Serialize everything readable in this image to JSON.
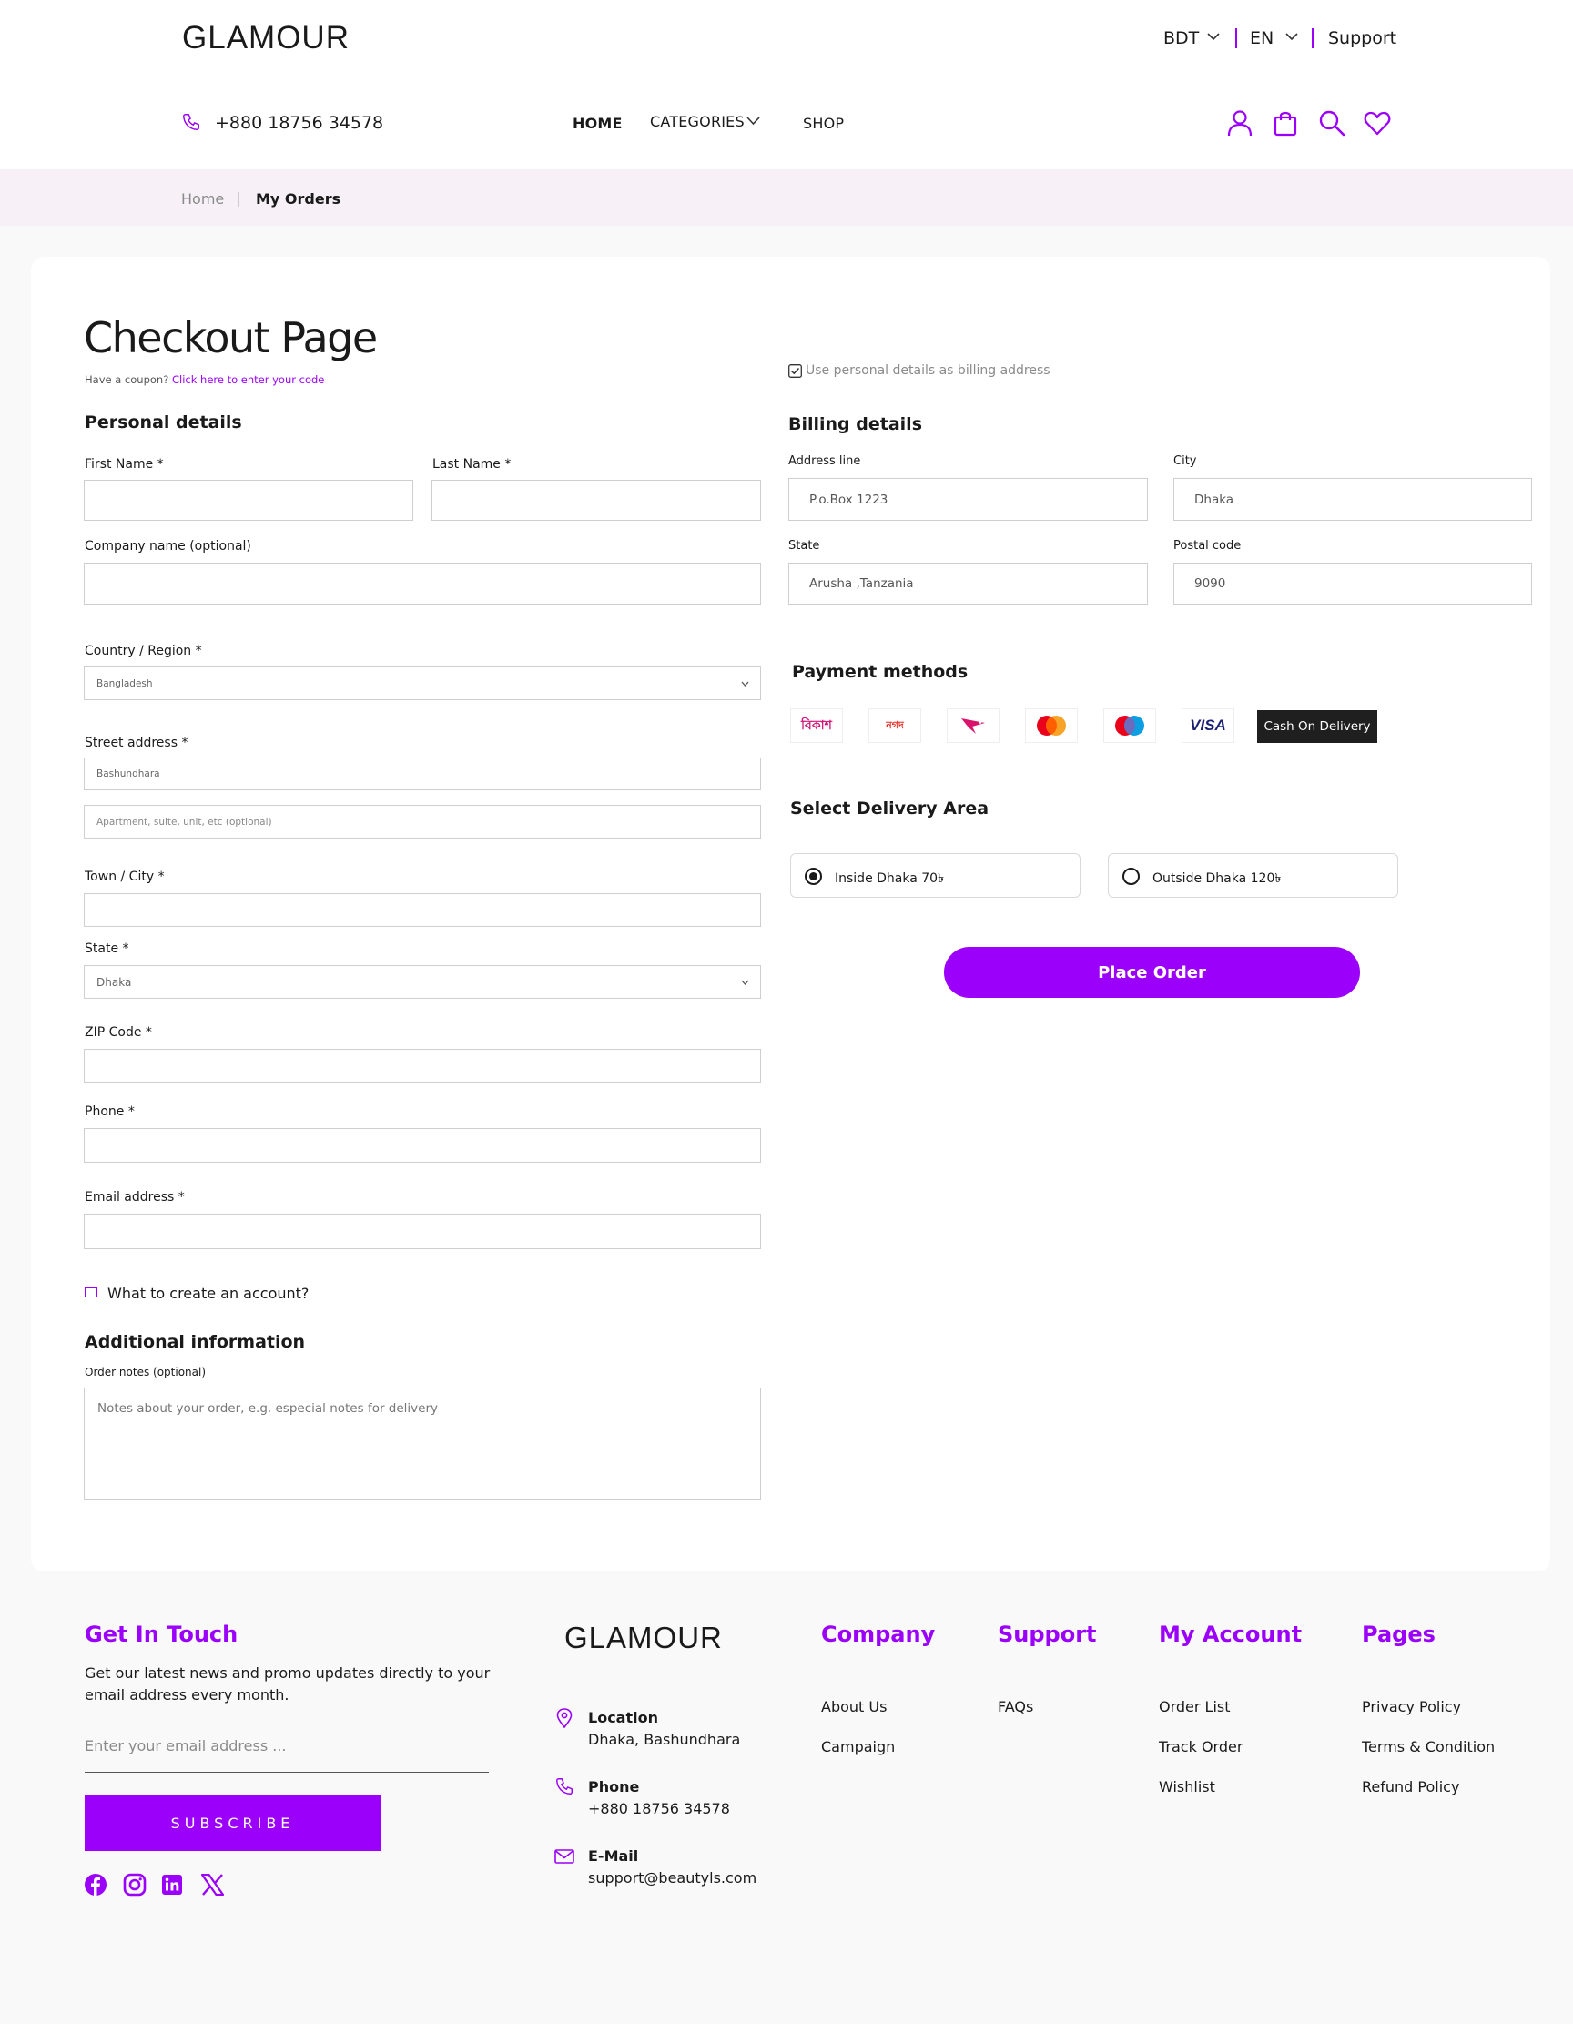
{
  "header": {
    "logo": "GLAMOUR",
    "currency": "BDT",
    "language": "EN",
    "support": "Support",
    "phone": "+880 18756 34578",
    "nav": {
      "home": "HOME",
      "categories": "CATEGORIES",
      "shop": "SHOP"
    }
  },
  "breadcrumb": {
    "home": "Home",
    "separator": "|",
    "current": "My Orders"
  },
  "checkout": {
    "title": "Checkout Page",
    "coupon_prefix": "Have a coupon?",
    "coupon_link": "Click here to enter your code",
    "billing_same": "Use personal details as billing address",
    "personal": {
      "heading": "Personal details",
      "first_name_label": "First Name *",
      "last_name_label": "Last Name *",
      "company_label": "Company name (optional)",
      "country_label": "Country / Region *",
      "country_value": "Bangladesh",
      "street_label": "Street address *",
      "street_value": "Bashundhara",
      "apartment_placeholder": "Apartment, suite, unit, etc (optional)",
      "town_label": "Town / City *",
      "state_label": "State *",
      "state_value": "Dhaka",
      "zip_label": "ZIP Code *",
      "phone_label": "Phone *",
      "email_label": "Email address *",
      "create_account": "What to create an account?"
    },
    "additional": {
      "heading": "Additional information",
      "notes_label": "Order notes (optional)",
      "notes_placeholder": "Notes about your order, e.g. especial notes for delivery"
    },
    "billing": {
      "heading": "Billing details",
      "address_label": "Address line",
      "address_value": "P.o.Box 1223",
      "city_label": "City",
      "city_value": "Dhaka",
      "state_label": "State",
      "state_value": "Arusha ,Tanzania",
      "postal_label": "Postal code",
      "postal_value": "9090"
    },
    "payment": {
      "heading": "Payment methods",
      "methods": [
        "bkash-logo",
        "nagad-logo",
        "rocket-logo",
        "mastercard-logo",
        "maestro-logo",
        "visa-logo"
      ],
      "cod_label": "Cash On Delivery",
      "maestro_text": "maestro",
      "mastercard_text": "mastercard",
      "visa_text": "VISA",
      "bkash_text": "বিকাশ",
      "nagad_text": "নগদ"
    },
    "delivery": {
      "heading": "Select Delivery Area",
      "inside": "Inside Dhaka 70৳",
      "outside": "Outside Dhaka 120৳"
    },
    "place_order": "Place Order"
  },
  "footer": {
    "touch_heading": "Get In Touch",
    "touch_text_1": "Get our latest news and promo updates directly to your",
    "touch_text_2": "email address every month.",
    "email_placeholder": "Enter your email address ...",
    "subscribe": "SUBSCRIBE",
    "logo": "GLAMOUR",
    "location_label": "Location",
    "location_value": "Dhaka, Bashundhara",
    "phone_label": "Phone",
    "phone_value": "+880 18756 34578",
    "email_label": "E-Mail",
    "email_value": "support@beautyls.com",
    "company": {
      "heading": "Company",
      "links": [
        "About Us",
        "Campaign"
      ]
    },
    "support": {
      "heading": "Support",
      "links": [
        "FAQs"
      ]
    },
    "account": {
      "heading": "My Account",
      "links": [
        "Order List",
        "Track Order",
        "Wishlist"
      ]
    },
    "pages": {
      "heading": "Pages",
      "links": [
        "Privacy Policy",
        "Terms & Condition",
        "Refund Policy"
      ]
    }
  },
  "colors": {
    "accent": "#9b00fa",
    "crumb_bg": "#f7f1f7",
    "page_bg": "#f9f9f9",
    "cod_bg": "#1f1f1f"
  }
}
